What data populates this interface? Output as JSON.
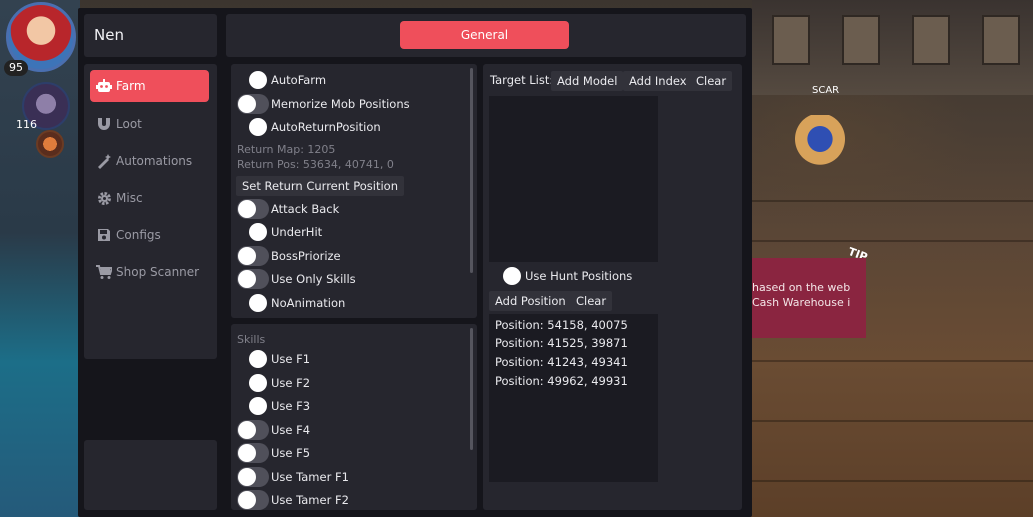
{
  "hud": {
    "player_level": "95",
    "pet_level": "116",
    "character_name": "SCAR",
    "tip_label": "TIP",
    "notice_lines": [
      "hased on the web",
      "Cash Warehouse i"
    ]
  },
  "colors": {
    "accent": "#ef4f5b",
    "panel": "#26262e",
    "window": "#15151b",
    "muted_text": "#80808a"
  },
  "app": {
    "title": "Nen"
  },
  "sidebar": {
    "items": [
      {
        "label": "Farm",
        "icon": "robot-icon",
        "active": true
      },
      {
        "label": "Loot",
        "icon": "magnet-icon",
        "active": false
      },
      {
        "label": "Automations",
        "icon": "magic-wand-icon",
        "active": false
      },
      {
        "label": "Misc",
        "icon": "gear-icon",
        "active": false
      },
      {
        "label": "Configs",
        "icon": "floppy-disk-icon",
        "active": false
      },
      {
        "label": "Shop Scanner",
        "icon": "cart-icon",
        "active": false
      }
    ]
  },
  "tabs": {
    "general": "General"
  },
  "farm": {
    "autofarm": "AutoFarm",
    "memorize_mob_positions": "Memorize Mob Positions",
    "auto_return_position": "AutoReturnPosition",
    "return_map": "Return Map: 1205",
    "return_pos": "Return Pos: 53634, 40741, 0",
    "set_return_button": "Set Return Current Position",
    "attack_back": "Attack Back",
    "under_hit": "UnderHit",
    "boss_priorize": "BossPriorize",
    "use_only_skills": "Use Only Skills",
    "no_animation": "NoAnimation"
  },
  "skills": {
    "section_label": "Skills",
    "items": [
      "Use F1",
      "Use F2",
      "Use F3",
      "Use F4",
      "Use F5",
      "Use Tamer F1",
      "Use Tamer F2"
    ]
  },
  "targets": {
    "label": "Target List:",
    "add_model": "Add Model",
    "add_index": "Add Index",
    "clear": "Clear"
  },
  "hunt": {
    "use_hunt_positions": "Use Hunt Positions",
    "add_position": "Add Position",
    "clear": "Clear",
    "positions": [
      "Position: 54158, 40075",
      "Position: 41525, 39871",
      "Position: 41243, 49341",
      "Position: 49962, 49931"
    ]
  }
}
